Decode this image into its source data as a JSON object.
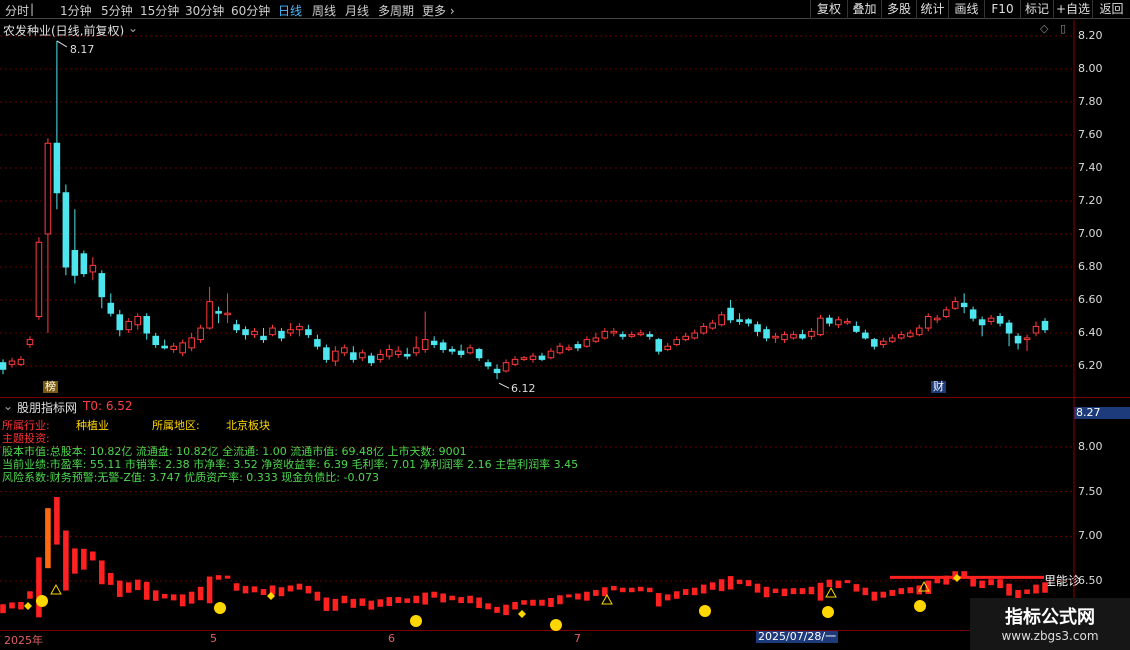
{
  "toolbar": {
    "timeframes": [
      "分时",
      "1分钟",
      "5分钟",
      "15分钟",
      "30分钟",
      "60分钟",
      "日线",
      "周线",
      "月线",
      "多周期",
      "更多"
    ],
    "active_timeframe": "日线",
    "buttons": [
      "复权",
      "叠加",
      "多股",
      "统计",
      "画线",
      "F10",
      "标记",
      "+自选",
      "返回"
    ]
  },
  "main_panel": {
    "title": "农发种业(日线,前复权)",
    "y_ticks": [
      "8.20",
      "8.00",
      "7.80",
      "7.60",
      "7.40",
      "7.20",
      "7.00",
      "6.80",
      "6.60",
      "6.40",
      "6.20"
    ],
    "high_label": "8.17",
    "low_label": "6.12",
    "badge_bang": "榜",
    "badge_cai": "财"
  },
  "indicator_panel": {
    "title": "股朋指标网",
    "t0": "T0: 6.52",
    "price_box": "8.27",
    "y_ticks": [
      "8.00",
      "7.50",
      "7.00",
      "6.50"
    ],
    "industry_label": "所属行业:",
    "industry_value": "种植业",
    "region_label": "所属地区:",
    "region_value": "北京板块",
    "theme_label": "主题投资:",
    "line_capital": "股本市值:总股本: 10.82亿 流通盘: 10.82亿 全流通: 1.00 流通市值: 69.48亿 上市天数: 9001",
    "line_perf": "当前业绩:市盈率: 55.11 市销率: 2.38 市净率: 3.52 净资收益率: 6.39 毛利率: 7.01 净利润率 2.16 主营利润率 3.45",
    "line_risk": "风险系数:财务预警:无警-Z值: 3.747 优质资产率: 0.333 现金负债比: -0.073",
    "side_text": "里能诊"
  },
  "x_axis": {
    "labels": [
      "2025年",
      "5",
      "6",
      "7"
    ],
    "cursor_date": "2025/07/28/一"
  },
  "watermark": {
    "cn": "指标公式网",
    "url": "www.zbgs3.com"
  },
  "colors": {
    "up": "#ff3b3b",
    "down": "#4ee6ee",
    "accent": "#4fb8ff"
  },
  "chart_data": {
    "type": "candlestick",
    "title": "农发种业(日线,前复权)",
    "ylim": [
      6.1,
      8.25
    ],
    "x_labels": [
      "2025年",
      "5",
      "6",
      "7"
    ],
    "candles": [
      [
        6.22,
        6.18,
        6.24,
        6.15
      ],
      [
        6.21,
        6.23,
        6.25,
        6.19
      ],
      [
        6.21,
        6.24,
        6.26,
        6.2
      ],
      [
        6.33,
        6.36,
        6.38,
        6.31
      ],
      [
        6.5,
        6.95,
        6.98,
        6.48
      ],
      [
        7.0,
        7.55,
        7.58,
        6.4
      ],
      [
        7.55,
        7.25,
        8.17,
        7.15
      ],
      [
        7.25,
        6.8,
        7.3,
        6.75
      ],
      [
        6.9,
        6.75,
        7.15,
        6.7
      ],
      [
        6.88,
        6.76,
        6.9,
        6.74
      ],
      [
        6.77,
        6.81,
        6.86,
        6.72
      ],
      [
        6.76,
        6.62,
        6.78,
        6.55
      ],
      [
        6.58,
        6.52,
        6.64,
        6.5
      ],
      [
        6.51,
        6.42,
        6.54,
        6.38
      ],
      [
        6.42,
        6.47,
        6.49,
        6.4
      ],
      [
        6.45,
        6.5,
        6.52,
        6.42
      ],
      [
        6.5,
        6.4,
        6.52,
        6.36
      ],
      [
        6.38,
        6.33,
        6.4,
        6.31
      ],
      [
        6.32,
        6.31,
        6.36,
        6.3
      ],
      [
        6.3,
        6.32,
        6.34,
        6.28
      ],
      [
        6.28,
        6.34,
        6.36,
        6.26
      ],
      [
        6.31,
        6.37,
        6.4,
        6.29
      ],
      [
        6.36,
        6.43,
        6.45,
        6.34
      ],
      [
        6.43,
        6.59,
        6.68,
        6.42
      ],
      [
        6.53,
        6.52,
        6.56,
        6.46
      ],
      [
        6.52,
        6.52,
        6.64,
        6.46
      ],
      [
        6.45,
        6.42,
        6.48,
        6.4
      ],
      [
        6.42,
        6.39,
        6.44,
        6.36
      ],
      [
        6.39,
        6.41,
        6.43,
        6.37
      ],
      [
        6.38,
        6.36,
        6.43,
        6.34
      ],
      [
        6.39,
        6.43,
        6.45,
        6.38
      ],
      [
        6.41,
        6.37,
        6.43,
        6.35
      ],
      [
        6.4,
        6.42,
        6.46,
        6.38
      ],
      [
        6.42,
        6.44,
        6.46,
        6.38
      ],
      [
        6.42,
        6.39,
        6.45,
        6.37
      ],
      [
        6.36,
        6.32,
        6.39,
        6.3
      ],
      [
        6.31,
        6.24,
        6.33,
        6.22
      ],
      [
        6.23,
        6.29,
        6.32,
        6.2
      ],
      [
        6.28,
        6.31,
        6.33,
        6.26
      ],
      [
        6.28,
        6.24,
        6.32,
        6.22
      ],
      [
        6.25,
        6.28,
        6.3,
        6.23
      ],
      [
        6.26,
        6.22,
        6.28,
        6.2
      ],
      [
        6.24,
        6.27,
        6.3,
        6.22
      ],
      [
        6.26,
        6.3,
        6.33,
        6.24
      ],
      [
        6.27,
        6.29,
        6.32,
        6.25
      ],
      [
        6.27,
        6.26,
        6.31,
        6.24
      ],
      [
        6.28,
        6.31,
        6.38,
        6.26
      ],
      [
        6.3,
        6.36,
        6.53,
        6.28
      ],
      [
        6.35,
        6.33,
        6.38,
        6.31
      ],
      [
        6.34,
        6.3,
        6.36,
        6.28
      ],
      [
        6.3,
        6.29,
        6.32,
        6.27
      ],
      [
        6.29,
        6.27,
        6.33,
        6.25
      ],
      [
        6.28,
        6.31,
        6.33,
        6.27
      ],
      [
        6.3,
        6.25,
        6.31,
        6.23
      ],
      [
        6.22,
        6.2,
        6.24,
        6.18
      ],
      [
        6.18,
        6.16,
        6.21,
        6.12
      ],
      [
        6.17,
        6.22,
        6.24,
        6.16
      ],
      [
        6.21,
        6.24,
        6.26,
        6.2
      ],
      [
        6.24,
        6.25,
        6.26,
        6.23
      ],
      [
        6.24,
        6.26,
        6.28,
        6.22
      ],
      [
        6.26,
        6.24,
        6.28,
        6.23
      ],
      [
        6.25,
        6.29,
        6.31,
        6.24
      ],
      [
        6.28,
        6.32,
        6.34,
        6.27
      ],
      [
        6.31,
        6.31,
        6.33,
        6.29
      ],
      [
        6.33,
        6.31,
        6.35,
        6.29
      ],
      [
        6.32,
        6.36,
        6.38,
        6.31
      ],
      [
        6.35,
        6.37,
        6.4,
        6.34
      ],
      [
        6.37,
        6.41,
        6.43,
        6.36
      ],
      [
        6.4,
        6.41,
        6.43,
        6.38
      ],
      [
        6.39,
        6.38,
        6.41,
        6.36
      ],
      [
        6.38,
        6.39,
        6.41,
        6.37
      ],
      [
        6.39,
        6.4,
        6.42,
        6.38
      ],
      [
        6.39,
        6.38,
        6.41,
        6.36
      ],
      [
        6.36,
        6.29,
        6.37,
        6.27
      ],
      [
        6.3,
        6.32,
        6.34,
        6.29
      ],
      [
        6.33,
        6.36,
        6.38,
        6.32
      ],
      [
        6.36,
        6.38,
        6.4,
        6.35
      ],
      [
        6.37,
        6.4,
        6.42,
        6.36
      ],
      [
        6.4,
        6.44,
        6.46,
        6.39
      ],
      [
        6.43,
        6.46,
        6.48,
        6.42
      ],
      [
        6.45,
        6.51,
        6.53,
        6.44
      ],
      [
        6.55,
        6.48,
        6.6,
        6.46
      ],
      [
        6.48,
        6.47,
        6.52,
        6.45
      ],
      [
        6.48,
        6.46,
        6.49,
        6.44
      ],
      [
        6.45,
        6.41,
        6.47,
        6.38
      ],
      [
        6.42,
        6.37,
        6.44,
        6.35
      ],
      [
        6.37,
        6.38,
        6.4,
        6.34
      ],
      [
        6.36,
        6.39,
        6.41,
        6.34
      ],
      [
        6.37,
        6.39,
        6.41,
        6.36
      ],
      [
        6.39,
        6.37,
        6.42,
        6.36
      ],
      [
        6.38,
        6.41,
        6.43,
        6.36
      ],
      [
        6.39,
        6.49,
        6.51,
        6.38
      ],
      [
        6.49,
        6.46,
        6.51,
        6.44
      ],
      [
        6.45,
        6.48,
        6.5,
        6.43
      ],
      [
        6.47,
        6.47,
        6.49,
        6.45
      ],
      [
        6.44,
        6.41,
        6.47,
        6.4
      ],
      [
        6.4,
        6.37,
        6.42,
        6.36
      ],
      [
        6.36,
        6.32,
        6.37,
        6.3
      ],
      [
        6.33,
        6.35,
        6.37,
        6.31
      ],
      [
        6.35,
        6.37,
        6.39,
        6.34
      ],
      [
        6.37,
        6.39,
        6.41,
        6.36
      ],
      [
        6.38,
        6.4,
        6.42,
        6.37
      ],
      [
        6.39,
        6.43,
        6.45,
        6.38
      ],
      [
        6.43,
        6.5,
        6.52,
        6.41
      ],
      [
        6.48,
        6.49,
        6.51,
        6.46
      ],
      [
        6.5,
        6.54,
        6.56,
        6.49
      ],
      [
        6.55,
        6.59,
        6.62,
        6.54
      ],
      [
        6.58,
        6.56,
        6.64,
        6.52
      ],
      [
        6.54,
        6.49,
        6.56,
        6.47
      ],
      [
        6.48,
        6.45,
        6.5,
        6.38
      ],
      [
        6.47,
        6.49,
        6.51,
        6.45
      ],
      [
        6.5,
        6.46,
        6.52,
        6.44
      ],
      [
        6.46,
        6.4,
        6.48,
        6.32
      ],
      [
        6.38,
        6.34,
        6.4,
        6.3
      ],
      [
        6.36,
        6.37,
        6.39,
        6.29
      ],
      [
        6.4,
        6.44,
        6.47,
        6.38
      ],
      [
        6.47,
        6.42,
        6.49,
        6.4
      ]
    ]
  }
}
